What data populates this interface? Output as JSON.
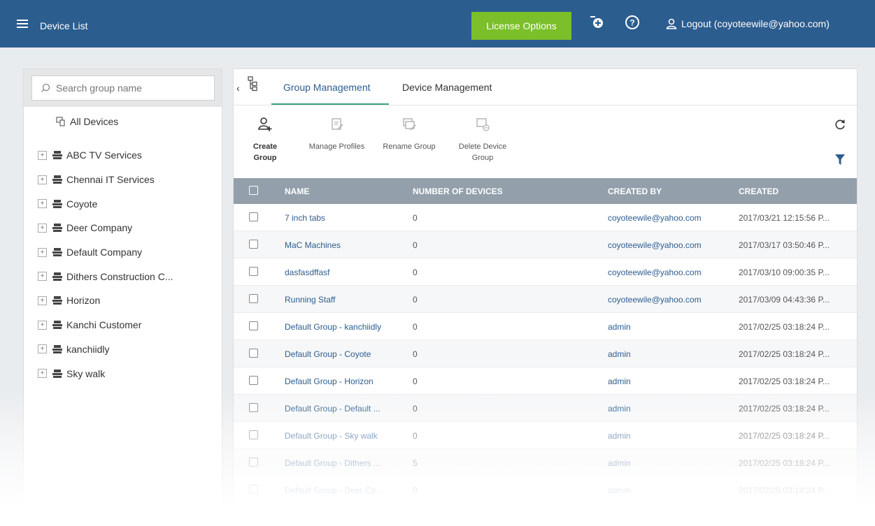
{
  "header": {
    "title": "Device List",
    "license_button": "License Options",
    "logout_label": "Logout (coyoteewile@yahoo.com)",
    "accent_color": "#7bbf2a",
    "bar_color": "#2c5d8f"
  },
  "sidebar": {
    "search_placeholder": "Search group name",
    "all_devices": "All Devices",
    "groups": [
      "ABC TV Services",
      "Chennai IT Services",
      "Coyote",
      "Deer Company",
      "Default Company",
      "Dithers Construction C...",
      "Horizon",
      "Kanchi Customer",
      "kanchiidly",
      "Sky walk"
    ]
  },
  "tabs": {
    "group_management": "Group Management",
    "device_management": "Device Management"
  },
  "toolbar": {
    "create_group": "Create Group",
    "manage_profiles": "Manage Profiles",
    "rename_group": "Rename Group",
    "delete_group_line1": "Delete Device",
    "delete_group_line2": "Group"
  },
  "table": {
    "columns": {
      "name": "NAME",
      "devices": "NUMBER OF DEVICES",
      "created_by": "CREATED BY",
      "created": "CREATED"
    },
    "rows": [
      {
        "name": "7 inch tabs",
        "devices": "0",
        "created_by": "coyoteewile@yahoo.com",
        "created": "2017/03/21 12:15:56 P..."
      },
      {
        "name": "MaC Machines",
        "devices": "0",
        "created_by": "coyoteewile@yahoo.com",
        "created": "2017/03/17 03:50:46 P..."
      },
      {
        "name": "dasfasdffasf",
        "devices": "0",
        "created_by": "coyoteewile@yahoo.com",
        "created": "2017/03/10 09:00:35 P..."
      },
      {
        "name": "Running Staff",
        "devices": "0",
        "created_by": "coyoteewile@yahoo.com",
        "created": "2017/03/09 04:43:36 P..."
      },
      {
        "name": "Default Group - kanchiidly",
        "devices": "0",
        "created_by": "admin",
        "created": "2017/02/25 03:18:24 P..."
      },
      {
        "name": "Default Group - Coyote",
        "devices": "0",
        "created_by": "admin",
        "created": "2017/02/25 03:18:24 P..."
      },
      {
        "name": "Default Group - Horizon",
        "devices": "0",
        "created_by": "admin",
        "created": "2017/02/25 03:18:24 P..."
      },
      {
        "name": "Default Group - Default ...",
        "devices": "0",
        "created_by": "admin",
        "created": "2017/02/25 03:18:24 P..."
      },
      {
        "name": "Default Group - Sky walk",
        "devices": "0",
        "created_by": "admin",
        "created": "2017/02/25 03:18:24 P..."
      },
      {
        "name": "Default Group - Dithers ...",
        "devices": "5",
        "created_by": "admin",
        "created": "2017/02/25 03:18:24 P..."
      },
      {
        "name": "Default Group - Deer Co...",
        "devices": "0",
        "created_by": "admin",
        "created": "2017/02/25 03:18:24 P..."
      }
    ]
  }
}
